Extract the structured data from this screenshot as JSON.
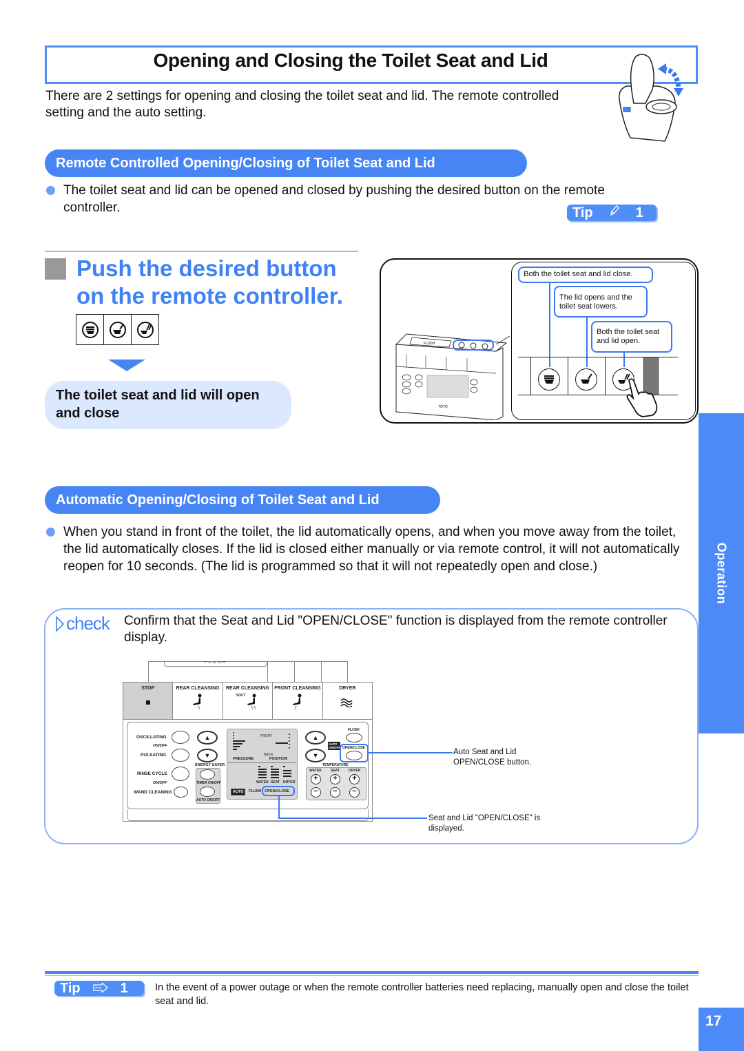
{
  "page": {
    "title": "Opening and Closing the Toilet Seat and Lid",
    "intro": "There are 2 settings for opening and closing the toilet seat and lid. The remote controlled setting and the auto setting.",
    "page_number": "17",
    "side_tab": "Operation",
    "accent_color": "#4785f5"
  },
  "section_remote": {
    "header": "Remote Controlled Opening/Closing of Toilet Seat and Lid",
    "bullet": "The toilet seat and lid can be opened and closed by pushing the desired button on the remote controller.",
    "tip": {
      "label": "Tip",
      "icon": "pencil-icon",
      "number": "1"
    }
  },
  "step": {
    "title_line1": "Push the desired button",
    "title_line2": "on the remote controller.",
    "buttons": [
      {
        "icon": "seat-lid-close-icon"
      },
      {
        "icon": "lid-open-seat-lower-icon"
      },
      {
        "icon": "seat-lid-open-icon"
      }
    ],
    "result": "The toilet seat and lid will open and close"
  },
  "illustration": {
    "callouts": [
      "Both the toilet seat and lid close.",
      "The lid opens and the toilet seat lowers.",
      "Both the toilet seat and lid open."
    ],
    "remote_labels": {
      "flush": "FLUSH",
      "brand": "TOTO"
    }
  },
  "section_auto": {
    "header": "Automatic Opening/Closing of Toilet Seat and Lid",
    "bullet": "When you stand in front of the toilet, the lid automatically opens, and when you move away from the toilet, the lid automatically closes. If the lid is closed either manually or via remote control, it will not automatically reopen for 10 seconds. (The lid is programmed so that it will not repeatedly open and close.)"
  },
  "check": {
    "label": "check",
    "text": "Confirm that the Seat and Lid \"OPEN/CLOSE\" function is displayed from the remote controller display.",
    "panel": {
      "flush_label": "FLUSH",
      "functions": [
        "STOP",
        "REAR CLEANSING",
        "REAR CLEANSING",
        "FRONT CLEANSING",
        "DRYER"
      ],
      "soft_label": "SOFT",
      "left_labels": {
        "oscillating": "OSCILLATING",
        "onoff1": "ON/OFF",
        "pulsating": "PULSATING",
        "rinse": "RINSE CYCLE",
        "onoff2": "ON/OFF",
        "wand": "WAND CLEANING"
      },
      "energy_saver": "ENERGY SAVER",
      "timer": "TIMER ON/OFF",
      "auto_onoff": "AUTO ON/OFF",
      "display": {
        "front": "FRONT",
        "back": "BACK",
        "pressure": "PRESSURE",
        "position": "POSITION",
        "water": "WATER",
        "seat": "SEAT",
        "dryer": "DRYER",
        "auto": "AUTO",
        "flush": "FLUSH",
        "open_close": "OPEN/CLOSE"
      },
      "right": {
        "flush": "FLUSH",
        "auto_onoff": "AUTO ON/OFF",
        "open_close": "OPEN/CLOSE",
        "temperature": "TEMPERATURE",
        "water": "WATER",
        "seat": "SEAT",
        "dryer": "DRYER"
      }
    },
    "caption_button": "Auto Seat and Lid OPEN/CLOSE button.",
    "caption_display": "Seat and Lid \"OPEN/CLOSE\" is displayed."
  },
  "footer_tip": {
    "label": "Tip",
    "icon": "arrow-reference-icon",
    "number": "1",
    "text": "In the event of a power outage or when the remote controller batteries need replacing, manually open and close the toilet seat and lid."
  }
}
